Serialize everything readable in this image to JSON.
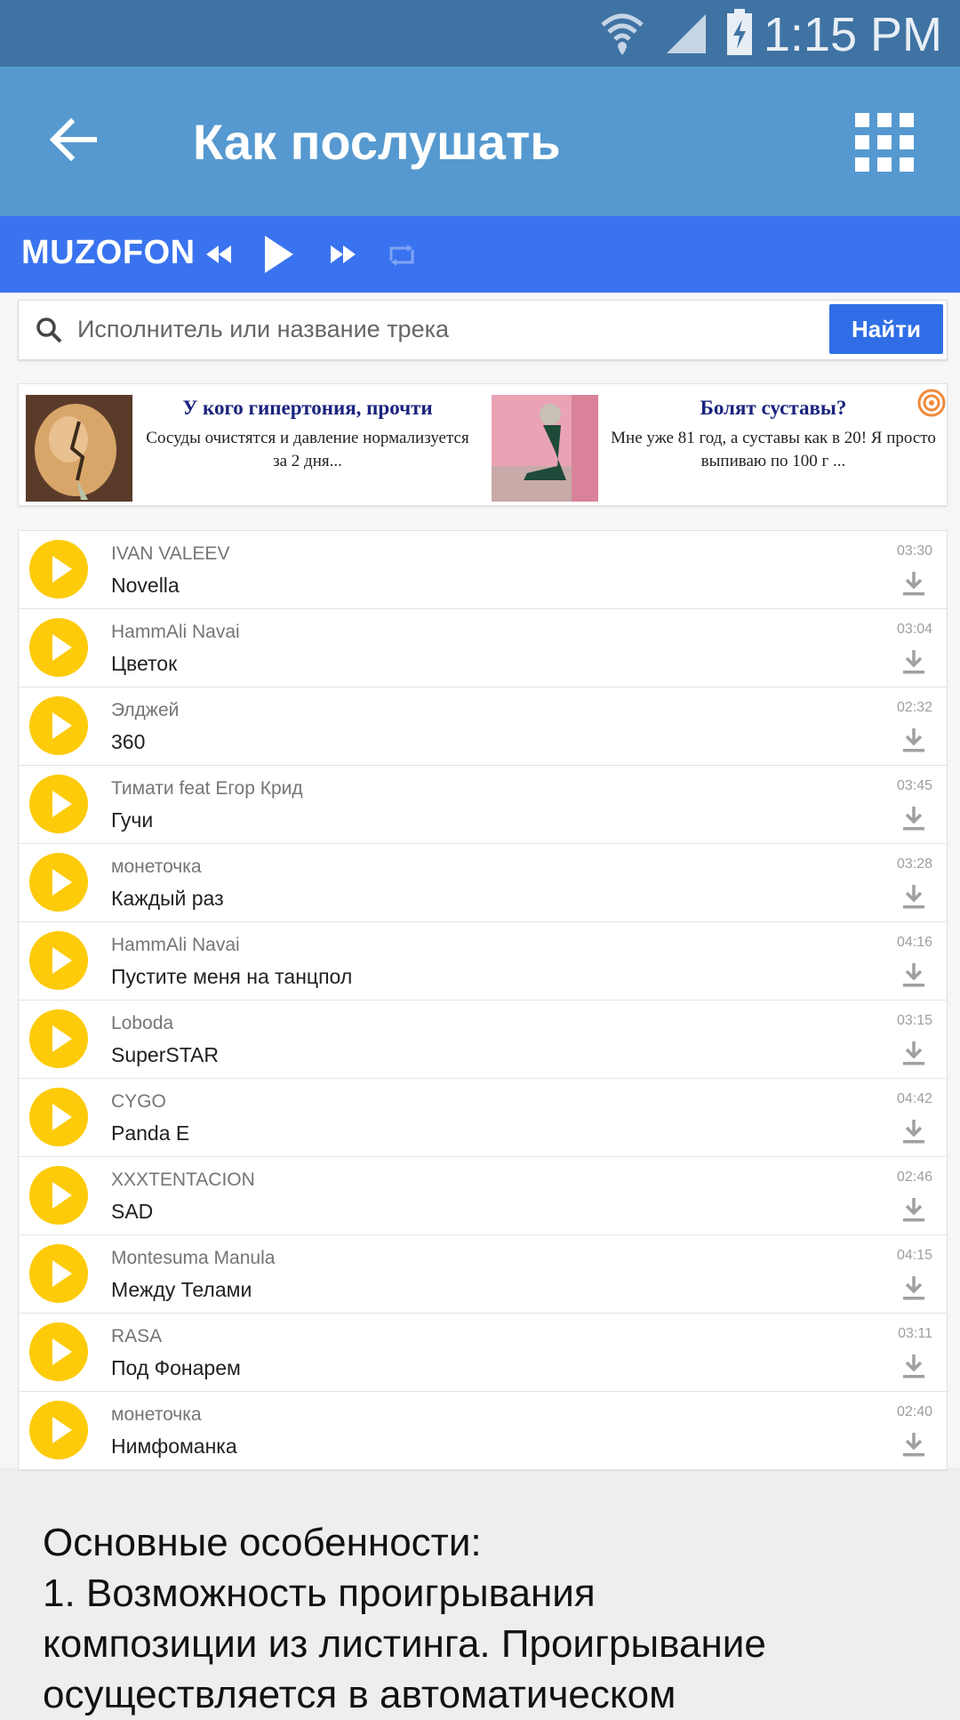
{
  "status_bar": {
    "time": "1:15 PM",
    "icons": [
      "wifi-icon",
      "signal-icon",
      "battery-charging-icon"
    ]
  },
  "app_bar": {
    "title": "Как послушать",
    "back_icon": "arrow-back-icon",
    "menu_icon": "apps-grid-icon"
  },
  "player": {
    "brand": "MUZOFON",
    "controls": [
      "rewind-icon",
      "play-icon",
      "fast-forward-icon",
      "repeat-icon"
    ]
  },
  "search": {
    "placeholder": "Исполнитель или название трека",
    "button": "Найти"
  },
  "ads": [
    {
      "title": "У кого гипертония, прочти",
      "text": "Сосуды очистятся и давление нормализуется за 2 дня..."
    },
    {
      "title": "Болят суставы?",
      "text": "Мне уже 81 год, а суставы как в 20! Я просто выпиваю по 100 г ..."
    }
  ],
  "tracks": [
    {
      "artist": "IVAN VALEEV",
      "title": "Novella",
      "duration": "03:30"
    },
    {
      "artist": "HammAli Navai",
      "title": "Цветок",
      "duration": "03:04"
    },
    {
      "artist": "Элджей",
      "title": "360",
      "duration": "02:32"
    },
    {
      "artist": "Тимати feat Егор Крид",
      "title": "Гучи",
      "duration": "03:45"
    },
    {
      "artist": "монеточка",
      "title": "Каждый раз",
      "duration": "03:28"
    },
    {
      "artist": "HammAli Navai",
      "title": "Пустите меня на танцпол",
      "duration": "04:16"
    },
    {
      "artist": "Loboda",
      "title": "SuperSTAR",
      "duration": "03:15"
    },
    {
      "artist": "CYGO",
      "title": "Panda E",
      "duration": "04:42"
    },
    {
      "artist": "XXXTENTACION",
      "title": "SAD",
      "duration": "02:46"
    },
    {
      "artist": "Montesuma Manula",
      "title": "Между Телами",
      "duration": "04:15"
    },
    {
      "artist": "RASA",
      "title": "Под Фонарем",
      "duration": "03:11"
    },
    {
      "artist": "монеточка",
      "title": "Нимфоманка",
      "duration": "02:40"
    }
  ],
  "description": {
    "heading": "Основные особенности:",
    "lines": [
      "1. Возможность проигрывания",
      "композиции из листинга. Проигрывание",
      "осуществляется в автоматическом"
    ]
  },
  "colors": {
    "status_bar": "#3f73a3",
    "app_bar": "#5599d0",
    "player_bar": "#3a73ef",
    "play_button": "#fdcb0a",
    "find_button": "#2f6ee6"
  }
}
